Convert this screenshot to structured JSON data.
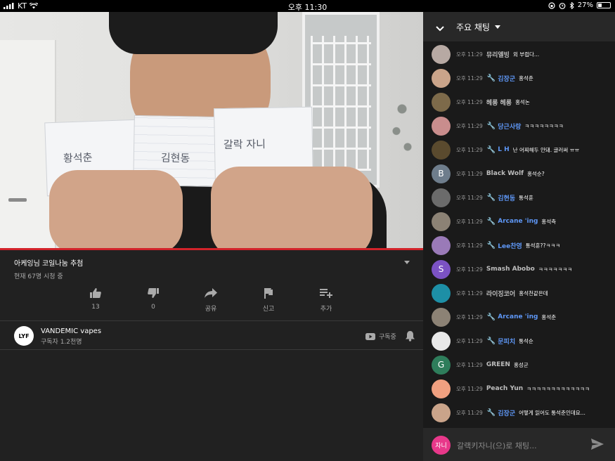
{
  "status_bar": {
    "carrier": "KT",
    "time": "오후 11:30",
    "battery": "27%",
    "battery_level": 0.27
  },
  "video": {
    "progress": 1.0,
    "paper_text": [
      "황석춘",
      "김현동",
      "갈락 자니"
    ]
  },
  "info": {
    "title": "아케잉님 코일나눔 추첨",
    "viewers": "현재 67명 시청 중",
    "actions": [
      {
        "icon": "thumbs-up-icon",
        "label": "13"
      },
      {
        "icon": "thumbs-down-icon",
        "label": "0"
      },
      {
        "icon": "share-icon",
        "label": "공유"
      },
      {
        "icon": "flag-icon",
        "label": "신고"
      },
      {
        "icon": "add-to-playlist-icon",
        "label": "추가"
      }
    ],
    "channel": {
      "name": "VANDEMIC vapes",
      "subscribers": "구독자 1.2천명",
      "logo_text": "LYF",
      "subscribed_label": "구독중"
    }
  },
  "chat": {
    "title": "주요 채팅",
    "input_avatar": "자니",
    "input_placeholder": "갈랙키자니(으)로 채팅...",
    "messages": [
      {
        "time": "오후 11:29",
        "author": "뮤리엘빙",
        "text": "외 부럽다...",
        "mod": false,
        "avatar": "#b7a9a3",
        "initial": ""
      },
      {
        "time": "오후 11:29",
        "author": "김장군",
        "text": "홍석춘",
        "mod": true,
        "avatar": "#caa48a",
        "initial": ""
      },
      {
        "time": "오후 11:29",
        "author": "헤롱 헤롱",
        "text": "홍석논",
        "mod": false,
        "avatar": "#7d6a4a",
        "initial": ""
      },
      {
        "time": "오후 11:29",
        "author": "당근사랑",
        "text": "ㅋㅋㅋㅋㅋㅋㅋㅋ",
        "mod": true,
        "avatar": "#c98d8d",
        "initial": ""
      },
      {
        "time": "오후 11:29",
        "author": "L H",
        "text": "난 어찌해두 안돼. 글러써 ㅠㅠ",
        "mod": true,
        "avatar": "#5a4a2e",
        "initial": ""
      },
      {
        "time": "오후 11:29",
        "author": "Black Wolf",
        "text": "홍석순?",
        "mod": false,
        "avatar": "#6e7d8c",
        "initial": "B"
      },
      {
        "time": "오후 11:29",
        "author": "김현동",
        "text": "통석훈",
        "mod": true,
        "avatar": "#6b6b6b",
        "initial": ""
      },
      {
        "time": "오후 11:29",
        "author": "Arcane 'ing",
        "text": "홍석측",
        "mod": true,
        "avatar": "#8c8275",
        "initial": ""
      },
      {
        "time": "오후 11:29",
        "author": "Lee찬영",
        "text": "통석훈??ㅋㅋㅋ",
        "mod": true,
        "avatar": "#9a7ab8",
        "initial": ""
      },
      {
        "time": "오후 11:29",
        "author": "Smash Abobo",
        "text": "ㅋㅋㅋㅋㅋㅋㅋ",
        "mod": false,
        "avatar": "#7b52c4",
        "initial": "S"
      },
      {
        "time": "오후 11:29",
        "author": "라이징코어",
        "text": "홍석천같은데",
        "mod": false,
        "avatar": "#1d8fa6",
        "initial": ""
      },
      {
        "time": "오후 11:29",
        "author": "Arcane 'ing",
        "text": "홍석춘",
        "mod": true,
        "avatar": "#8c8275",
        "initial": ""
      },
      {
        "time": "오후 11:29",
        "author": "문피치",
        "text": "통석순",
        "mod": true,
        "avatar": "#e8e8e8",
        "initial": ""
      },
      {
        "time": "오후 11:29",
        "author": "GREEN",
        "text": "홍성군",
        "mod": false,
        "avatar": "#2e7d5b",
        "initial": "G"
      },
      {
        "time": "오후 11:29",
        "author": "Peach Yun",
        "text": "ㅋㅋㅋㅋㅋㅋㅋㅋㅋㅋㅋㅋㅋ",
        "mod": false,
        "avatar": "#f0a080",
        "initial": ""
      },
      {
        "time": "오후 11:29",
        "author": "김장군",
        "text": "어떻게 읽어도 통석춘인데요...",
        "mod": true,
        "avatar": "#caa48a",
        "initial": ""
      }
    ]
  }
}
